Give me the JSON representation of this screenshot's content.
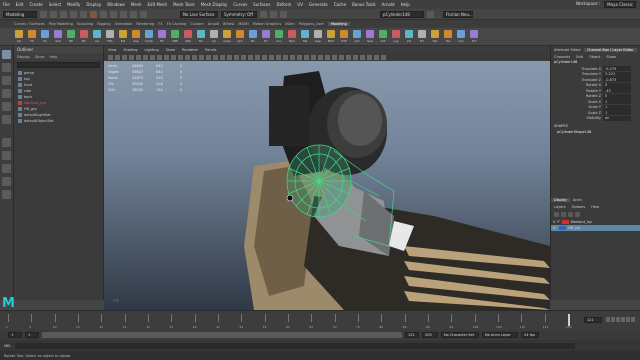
{
  "menubar": {
    "items": [
      "File",
      "Edit",
      "Create",
      "Select",
      "Modify",
      "Display",
      "Windows",
      "Mesh",
      "Edit Mesh",
      "Mesh Tools",
      "Mesh Display",
      "Curves",
      "Surfaces",
      "Deform",
      "UV",
      "Generate",
      "Cache",
      "Bonus Tools",
      "Arnold",
      "Help"
    ],
    "workspace_label": "Workspace :",
    "workspace_value": "Maya Classic"
  },
  "statusline": {
    "mode": "Modeling",
    "no_live_surface": "No Live Surface",
    "symmetry": "Symmetry: Off",
    "selected_object": "pCylinder148",
    "user": "Florian Neu..."
  },
  "shelf": {
    "tabs": [
      "Curves / Surfaces",
      "Poly Modeling",
      "Sculpting",
      "Rigging",
      "Animation",
      "Rendering",
      "FX",
      "FX Caching",
      "Custom",
      "Arnold",
      "Bifrost",
      "MASH",
      "Motion Graphics",
      "XGen",
      "Polygons_User",
      "Modeling"
    ],
    "active_tab": "Modeling",
    "tools": [
      "Sel",
      "FP",
      "SX",
      "Sub",
      "BP",
      "Mir",
      "Ins",
      "FPC",
      "Ext",
      "Sep",
      "Comb",
      "Fill",
      "CBE",
      "ANS",
      "Tar",
      "Cyl",
      "Cube",
      "Sph",
      "Pln",
      "Tor",
      "Con",
      "Pipe",
      "Hel",
      "Gear",
      "MUV",
      "UVE",
      "Cut",
      "Sew",
      "Unf",
      "Lay",
      "Ctr",
      "Frz",
      "Del",
      "His",
      "Grp",
      "Prt"
    ]
  },
  "outliner": {
    "title": "Outliner",
    "menus": [
      "Display",
      "Show",
      "Help"
    ],
    "items": [
      {
        "label": "persp",
        "state": "normal"
      },
      {
        "label": "top",
        "state": "normal"
      },
      {
        "label": "front",
        "state": "normal"
      },
      {
        "label": "side",
        "state": "normal"
      },
      {
        "label": "back",
        "state": "normal"
      },
      {
        "label": "Workout_grp",
        "state": "red"
      },
      {
        "label": "HR_grp",
        "state": "normal"
      },
      {
        "label": "defaultLightSet",
        "state": "normal"
      },
      {
        "label": "defaultObjectSet",
        "state": "normal"
      }
    ]
  },
  "viewport": {
    "menus": [
      "View",
      "Shading",
      "Lighting",
      "Show",
      "Renderer",
      "Panels"
    ],
    "hud": [
      {
        "label": "Verts",
        "v1": "24840",
        "v2": "640",
        "v3": "0"
      },
      {
        "label": "Edges",
        "v1": "49647",
        "v2": "844",
        "v3": "0"
      },
      {
        "label": "Faces",
        "v1": "24873",
        "v2": "416",
        "v3": "0"
      },
      {
        "label": "Tris",
        "v1": "49040",
        "v2": "416",
        "v3": "0"
      },
      {
        "label": "UVs",
        "v1": "26032",
        "v2": "740",
        "v3": "0"
      }
    ],
    "axis": "persp"
  },
  "channelbox": {
    "tabs": [
      "Attribute Editor",
      "Channel Box / Layer Editor"
    ],
    "menus": [
      "Channels",
      "Edit",
      "Object",
      "Show"
    ],
    "object": "pCylinder148",
    "attrs": [
      {
        "name": "Translate X",
        "value": "-9.279"
      },
      {
        "name": "Translate Y",
        "value": "3.223"
      },
      {
        "name": "Translate Z",
        "value": "-0.873"
      },
      {
        "name": "Rotate X",
        "value": "0"
      },
      {
        "name": "Rotate Y",
        "value": "-45"
      },
      {
        "name": "Rotate Z",
        "value": "0"
      },
      {
        "name": "Scale X",
        "value": "1"
      },
      {
        "name": "Scale Y",
        "value": "1"
      },
      {
        "name": "Scale Z",
        "value": "1"
      },
      {
        "name": "Visibility",
        "value": "on"
      }
    ],
    "shapes_label": "SHAPES",
    "shape": "pCylinderShape148",
    "layer_tabs": [
      "Display",
      "Anim"
    ],
    "layer_menus": [
      "Layers",
      "Options",
      "Help"
    ],
    "layers": [
      {
        "v": "V",
        "p": "P",
        "color": "#d32f2f",
        "name": "Workout_lay",
        "sel": false
      },
      {
        "v": "V",
        "p": "",
        "color": "#2d64c8",
        "name": "HR_lay",
        "sel": true
      }
    ]
  },
  "timeline": {
    "labels": [
      "1",
      "5",
      "10",
      "15",
      "20",
      "25",
      "30",
      "35",
      "40",
      "45",
      "50",
      "55",
      "60",
      "65",
      "70",
      "75",
      "80",
      "85",
      "90",
      "95",
      "100",
      "105",
      "110",
      "115",
      "120"
    ],
    "current_frame": "121"
  },
  "range": {
    "start": "1",
    "inner_start": "1",
    "inner_end": "121",
    "end": "200",
    "no_char": "No Character Set",
    "no_anim_layer": "No Anim Layer",
    "fps": "24 fps"
  },
  "cmdline": {
    "lang": "MEL"
  },
  "helpline": {
    "text": "Rotate Tool: Select an object to rotate."
  },
  "colors": {
    "accent": "#25c9d6",
    "selection": "#5e89a6",
    "wireframe": "#41d98f"
  }
}
